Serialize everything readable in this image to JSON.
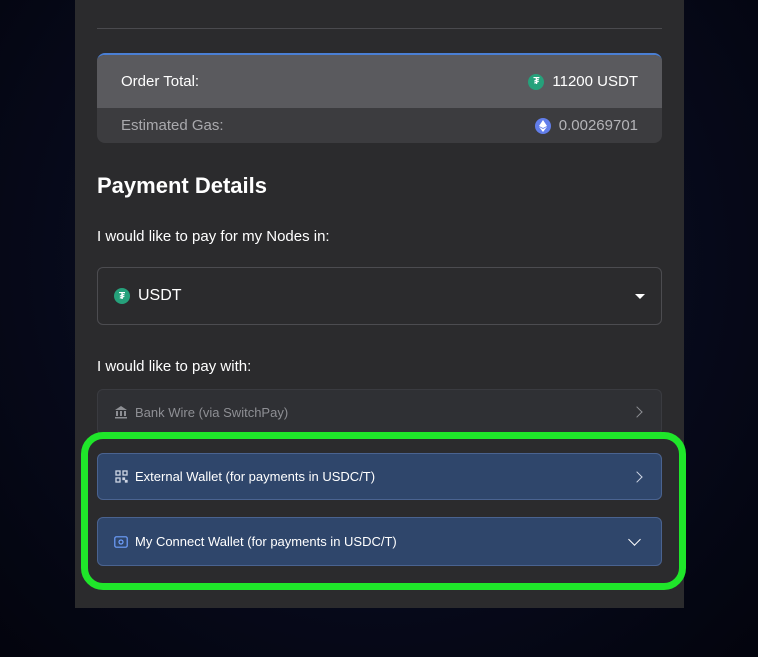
{
  "order_summary": {
    "total_label": "Order Total:",
    "total_value": "11200 USDT",
    "total_icon": "usdt-coin-icon",
    "gas_label": "Estimated Gas:",
    "gas_value": "0.00269701",
    "gas_icon": "eth-coin-icon"
  },
  "payment": {
    "title": "Payment Details",
    "currency_prompt": "I would like to pay for my Nodes in:",
    "currency_selected": "USDT",
    "method_prompt": "I would like to pay with:",
    "methods": [
      {
        "label": "Bank Wire (via SwitchPay)",
        "icon": "bank-icon",
        "state": "disabled"
      },
      {
        "label": "External Wallet (for payments in USDC/T)",
        "icon": "qr-code-icon",
        "state": "collapsed"
      },
      {
        "label": "My Connect Wallet (for payments in USDC/T)",
        "icon": "wallet-icon",
        "state": "expanded"
      }
    ]
  },
  "colors": {
    "accent_blue": "#2f466b",
    "highlight_green": "#1fe62a",
    "usdt_green": "#26a17b",
    "eth_purple": "#627eea"
  }
}
